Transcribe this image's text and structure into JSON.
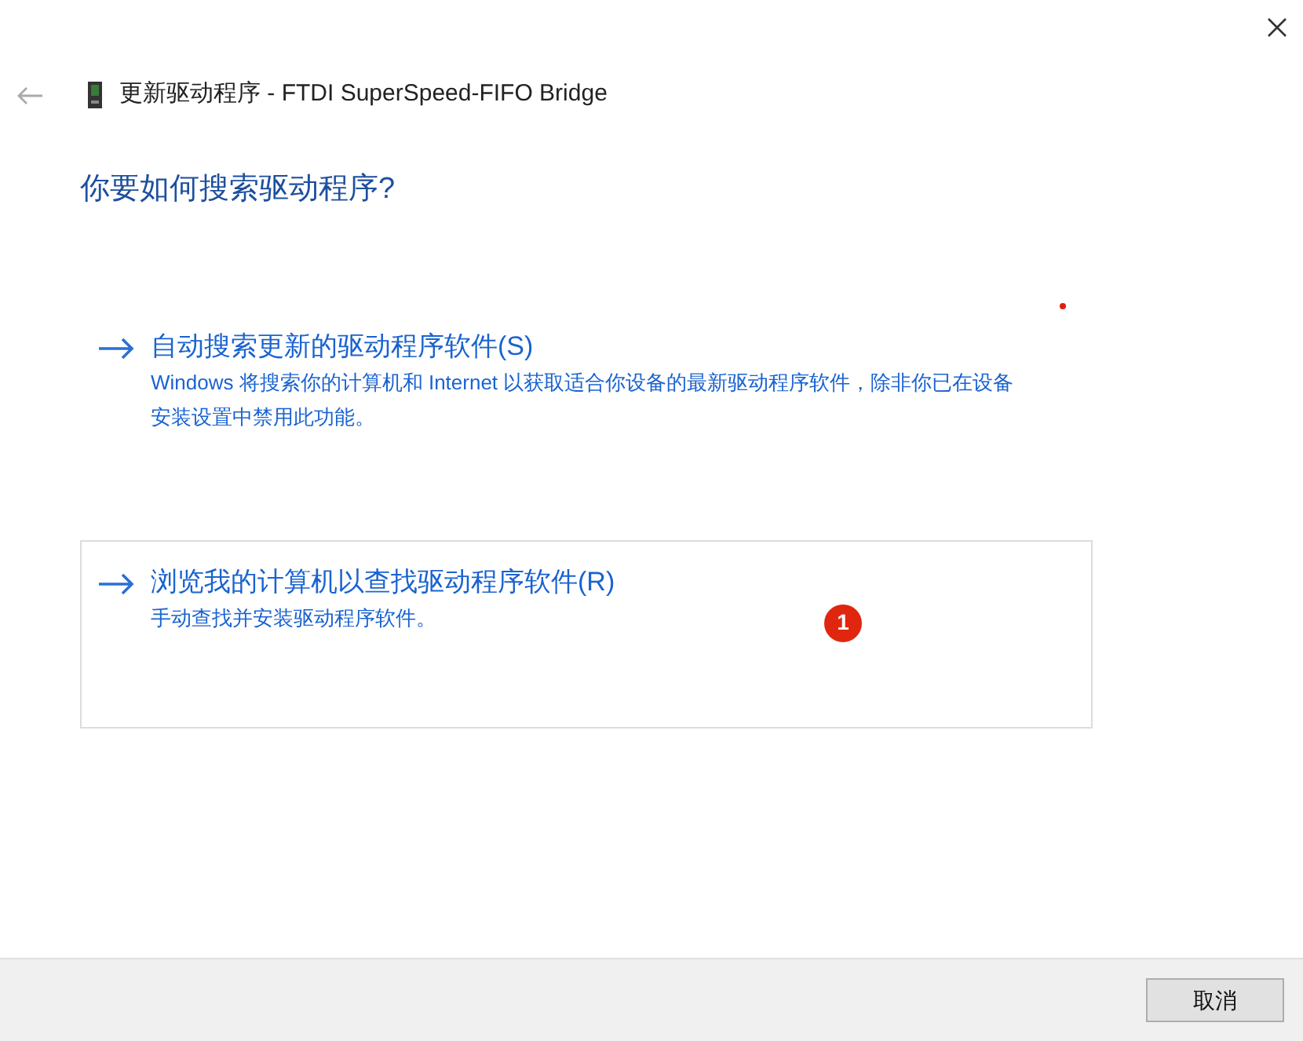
{
  "window": {
    "title": "更新驱动程序 - FTDI SuperSpeed-FIFO Bridge"
  },
  "heading": "你要如何搜索驱动程序?",
  "options": [
    {
      "title": "自动搜索更新的驱动程序软件(S)",
      "description": "Windows 将搜索你的计算机和 Internet 以获取适合你设备的最新驱动程序软件，除非你已在设备安装设置中禁用此功能。",
      "selected": false
    },
    {
      "title": "浏览我的计算机以查找驱动程序软件(R)",
      "description": "手动查找并安装驱动程序软件。",
      "selected": true,
      "badge": "1"
    }
  ],
  "buttons": [
    "取消"
  ]
}
